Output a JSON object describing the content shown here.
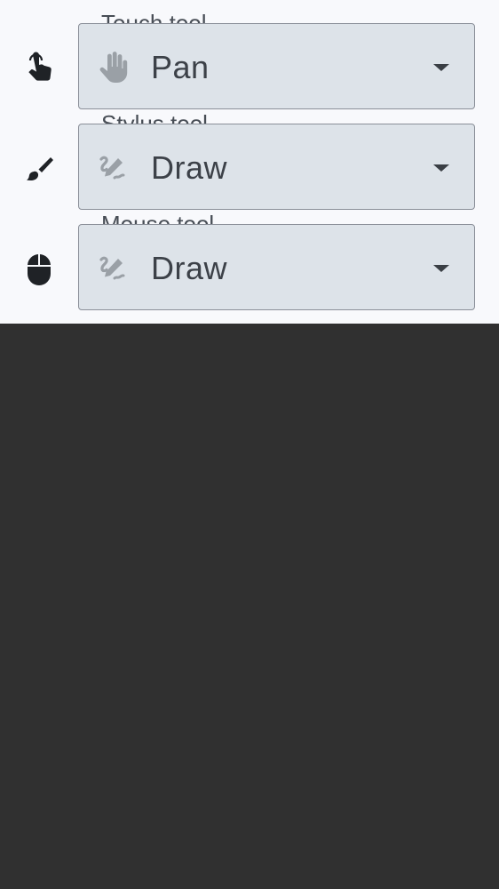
{
  "settings": {
    "rows": [
      {
        "label": "Touch tool",
        "lead_icon": "touch-finger-icon",
        "value": "Pan",
        "value_icon": "hand-icon"
      },
      {
        "label": "Stylus tool",
        "lead_icon": "brush-icon",
        "value": "Draw",
        "value_icon": "draw-icon"
      },
      {
        "label": "Mouse tool",
        "lead_icon": "mouse-icon",
        "value": "Draw",
        "value_icon": "draw-icon"
      }
    ]
  },
  "colors": {
    "panel_background": "#f8f9fc",
    "select_background": "#dde3e9",
    "page_background": "#303030",
    "text": "#3c4148",
    "icon_muted": "#9aa0a6"
  }
}
